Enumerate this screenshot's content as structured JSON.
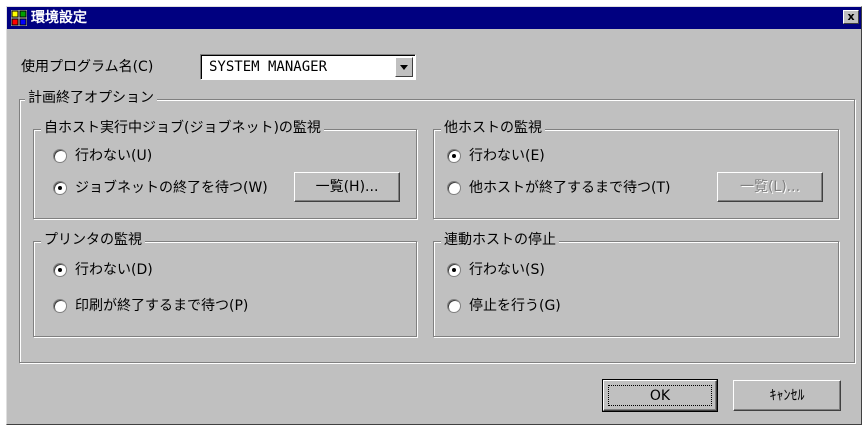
{
  "window": {
    "title": "環境設定",
    "close_glyph": "x"
  },
  "program": {
    "label": "使用プログラム名(C)",
    "value": "SYSTEM MANAGER"
  },
  "options": {
    "title": "計画終了オプション",
    "own_host": {
      "title": "自ホスト実行中ジョブ(ジョブネット)の監視",
      "opt_none": "行わない(U)",
      "opt_wait": "ジョブネットの終了を待つ(W)",
      "selected": "wait",
      "list_button": "一覧(H)..."
    },
    "other_host": {
      "title": "他ホストの監視",
      "opt_none": "行わない(E)",
      "opt_wait": "他ホストが終了するまで待つ(T)",
      "selected": "none",
      "list_button": "一覧(L)..."
    },
    "printer": {
      "title": "プリンタの監視",
      "opt_none": "行わない(D)",
      "opt_wait": "印刷が終了するまで待つ(P)",
      "selected": "none"
    },
    "linked_host": {
      "title": "連動ホストの停止",
      "opt_none": "行わない(S)",
      "opt_stop": "停止を行う(G)",
      "selected": "none"
    }
  },
  "buttons": {
    "ok": "OK",
    "cancel": "ｷｬﾝｾﾙ"
  }
}
